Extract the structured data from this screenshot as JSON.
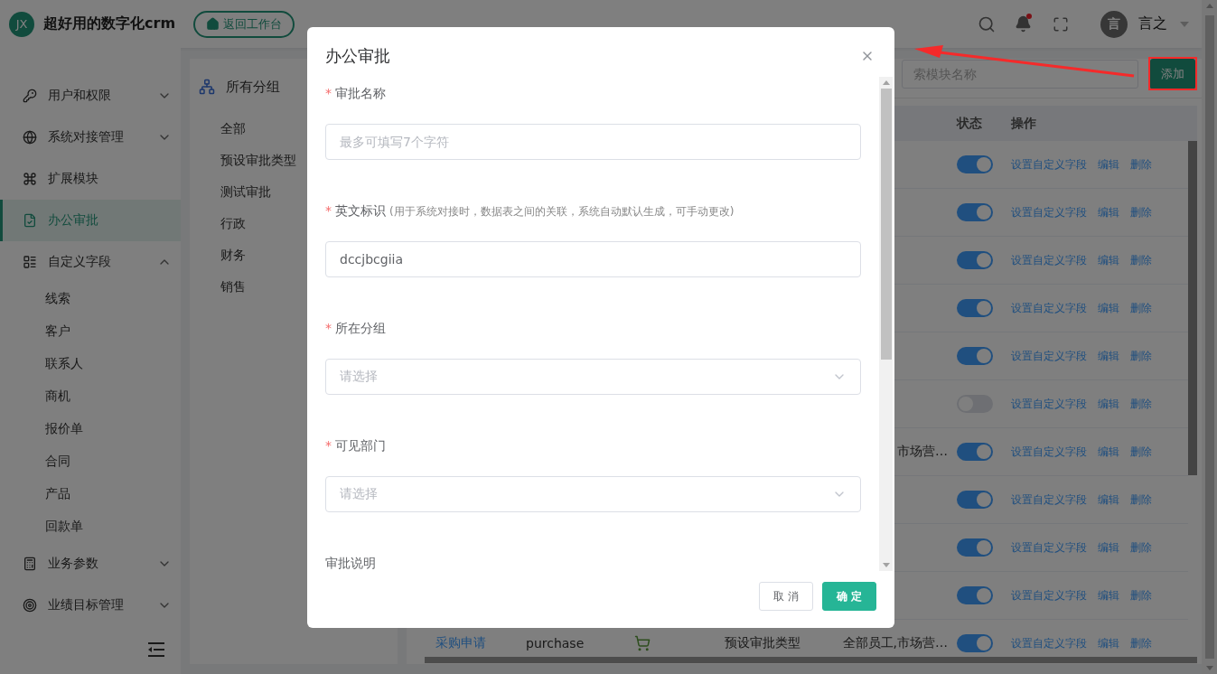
{
  "header": {
    "logo_text": "JX",
    "app_title": "超好用的数字化crm",
    "back_button": "返回工作台",
    "has_unread": true,
    "user": {
      "avatar_text": "言",
      "name": "言之"
    }
  },
  "sidebar": {
    "items": [
      {
        "label": "用户和权限",
        "selected": false,
        "expanded": false
      },
      {
        "label": "系统对接管理",
        "selected": false,
        "expanded": false
      },
      {
        "label": "扩展模块",
        "selected": false
      },
      {
        "label": "办公审批",
        "selected": true
      },
      {
        "label": "自定义字段",
        "selected": false,
        "expanded": true,
        "children": [
          {
            "label": "线索"
          },
          {
            "label": "客户"
          },
          {
            "label": "联系人"
          },
          {
            "label": "商机"
          },
          {
            "label": "报价单"
          },
          {
            "label": "合同"
          },
          {
            "label": "产品"
          },
          {
            "label": "回款单"
          }
        ]
      },
      {
        "label": "业务参数",
        "selected": false,
        "expanded": false
      },
      {
        "label": "业绩目标管理",
        "selected": false,
        "expanded": false
      }
    ]
  },
  "groups": {
    "title": "所有分组",
    "items": [
      {
        "label": "全部"
      },
      {
        "label": "预设审批类型"
      },
      {
        "label": "测试审批"
      },
      {
        "label": "行政"
      },
      {
        "label": "财务"
      },
      {
        "label": "销售"
      }
    ]
  },
  "toolbar": {
    "search": {
      "placeholder": "索模块名称"
    },
    "add_button": "添加"
  },
  "table": {
    "columns": [
      {
        "label": "状态"
      },
      {
        "label": "操作"
      }
    ],
    "rows": [
      {
        "on": true,
        "actions": [
          "设置自定义字段",
          "编辑",
          "删除"
        ]
      },
      {
        "on": true,
        "actions": [
          "设置自定义字段",
          "编辑",
          "删除"
        ]
      },
      {
        "on": true,
        "actions": [
          "设置自定义字段",
          "编辑",
          "删除"
        ]
      },
      {
        "on": true,
        "actions": [
          "设置自定义字段",
          "编辑",
          "删除"
        ]
      },
      {
        "on": true,
        "actions": [
          "设置自定义字段",
          "编辑",
          "删除"
        ]
      },
      {
        "on": false,
        "actions": [
          "设置自定义字段",
          "编辑",
          "删除"
        ]
      },
      {
        "scope": "市场营…",
        "on": true,
        "actions": [
          "设置自定义字段",
          "编辑",
          "删除"
        ]
      },
      {
        "on": true,
        "actions": [
          "设置自定义字段",
          "编辑",
          "删除"
        ]
      },
      {
        "on": true,
        "actions": [
          "设置自定义字段",
          "编辑",
          "删除"
        ]
      },
      {
        "on": true,
        "actions": [
          "设置自定义字段",
          "编辑",
          "删除"
        ]
      },
      {
        "name": "采购申请",
        "code": "purchase",
        "has_icon": true,
        "group": "预设审批类型",
        "scope": "全部员工,市场营…",
        "on": true,
        "actions": [
          "设置自定义字段",
          "编辑",
          "删除"
        ]
      }
    ]
  },
  "modal": {
    "title": "办公审批",
    "fields": [
      {
        "kind": "input",
        "required_mark": "*",
        "label": "审批名称",
        "placeholder": "最多可填写7个字符"
      },
      {
        "kind": "input",
        "required_mark": "*",
        "label": "英文标识",
        "hint": "(用于系统对接时，数据表之间的关联，系统自动默认生成，可手动更改)",
        "value": "dccjbcgiia"
      },
      {
        "kind": "select",
        "required_mark": "*",
        "label": "所在分组",
        "placeholder": "请选择"
      },
      {
        "kind": "select",
        "required_mark": "*",
        "label": "可见部门",
        "placeholder": "请选择"
      },
      {
        "kind": "textarea",
        "label": "审批说明"
      }
    ],
    "buttons": [
      {
        "kind": "default",
        "label": "取 消"
      },
      {
        "kind": "primary",
        "label": "确 定"
      }
    ]
  }
}
